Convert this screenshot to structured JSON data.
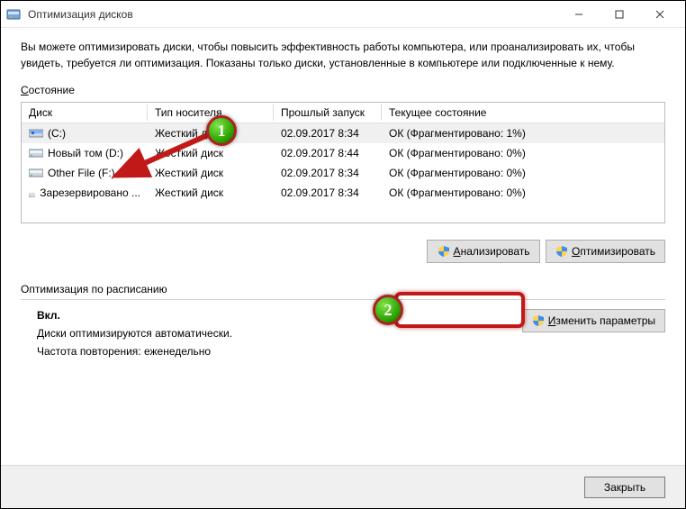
{
  "window": {
    "title": "Оптимизация дисков"
  },
  "description": "Вы можете оптимизировать диски, чтобы повысить эффективность работы  компьютера, или проанализировать их, чтобы увидеть, требуется ли оптимизация. Показаны только диски, установленные в компьютере или подключенные к нему.",
  "state_label_u": "С",
  "state_label_rest": "остояние",
  "columns": {
    "disk": "Диск",
    "media": "Тип носителя",
    "last": "Прошлый запуск",
    "status": "Текущее состояние"
  },
  "rows": [
    {
      "name": "(C:)",
      "selected": true,
      "media": "Жесткий диск",
      "last": "02.09.2017 8:34",
      "status": "ОК (Фрагментировано: 1%)"
    },
    {
      "name": "Новый том (D:)",
      "selected": false,
      "media": "Жесткий диск",
      "last": "02.09.2017 8:44",
      "status": "ОК (Фрагментировано: 0%)"
    },
    {
      "name": "Other File (F:)",
      "selected": false,
      "media": "Жесткий диск",
      "last": "02.09.2017 8:34",
      "status": "ОК (Фрагментировано: 0%)"
    },
    {
      "name": "Зарезервировано ...",
      "selected": false,
      "media": "Жесткий диск",
      "last": "02.09.2017 8:34",
      "status": "ОК (Фрагментировано: 0%)"
    }
  ],
  "buttons": {
    "analyze_u": "А",
    "analyze_rest": "нализировать",
    "optimize_u": "О",
    "optimize_rest": "птимизировать",
    "change_u": "И",
    "change_rest": "зменить параметры",
    "close_u": "З",
    "close_rest": "акрыть"
  },
  "schedule": {
    "title": "Оптимизация по расписанию",
    "enabled": "Вкл.",
    "line1": "Диски оптимизируются автоматически.",
    "line2": "Частота повторения: еженедельно"
  },
  "callouts": {
    "one": "1",
    "two": "2"
  }
}
